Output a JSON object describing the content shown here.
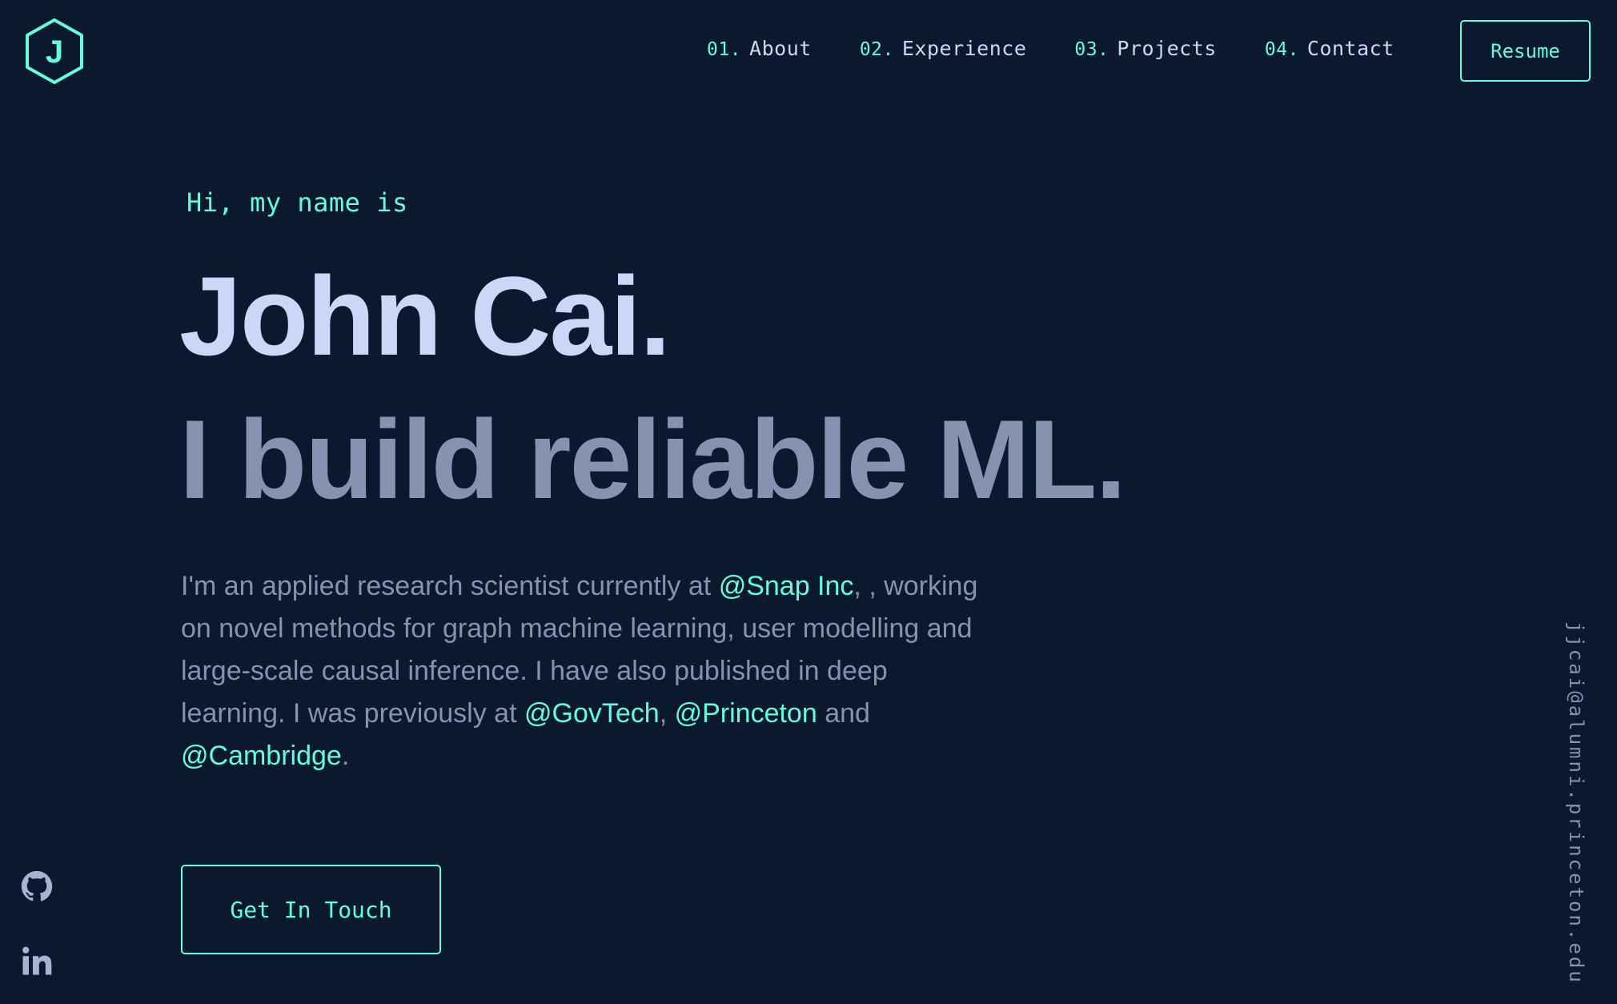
{
  "logo": {
    "letter": "J",
    "icon": "hexagon-logo-icon"
  },
  "nav": {
    "items": [
      {
        "num": "01.",
        "label": "About"
      },
      {
        "num": "02.",
        "label": "Experience"
      },
      {
        "num": "03.",
        "label": "Projects"
      },
      {
        "num": "04.",
        "label": "Contact"
      }
    ],
    "resume_label": "Resume"
  },
  "hero": {
    "greeting": "Hi, my name is",
    "name": "John Cai.",
    "tagline": "I build reliable ML.",
    "bio": {
      "p1": "I'm an applied research scientist currently at ",
      "link_snap": "@Snap Inc",
      "p2": ", , working on novel methods for graph machine learning, user modelling and large-scale causal inference. I have also published in deep learning. I was previously at ",
      "link_govtech": "@GovTech",
      "sep1": ", ",
      "link_princeton": "@Princeton",
      "sep2": " and ",
      "link_cambridge": "@Cambridge",
      "end": "."
    },
    "cta_label": "Get In Touch"
  },
  "social": {
    "items": [
      "github-icon",
      "linkedin-icon"
    ]
  },
  "email": "jjcai@alumni.princeton.edu",
  "colors": {
    "background": "#0b192e",
    "accent": "#64ffda",
    "heading": "#ccd6f6",
    "body": "#8892b0"
  }
}
